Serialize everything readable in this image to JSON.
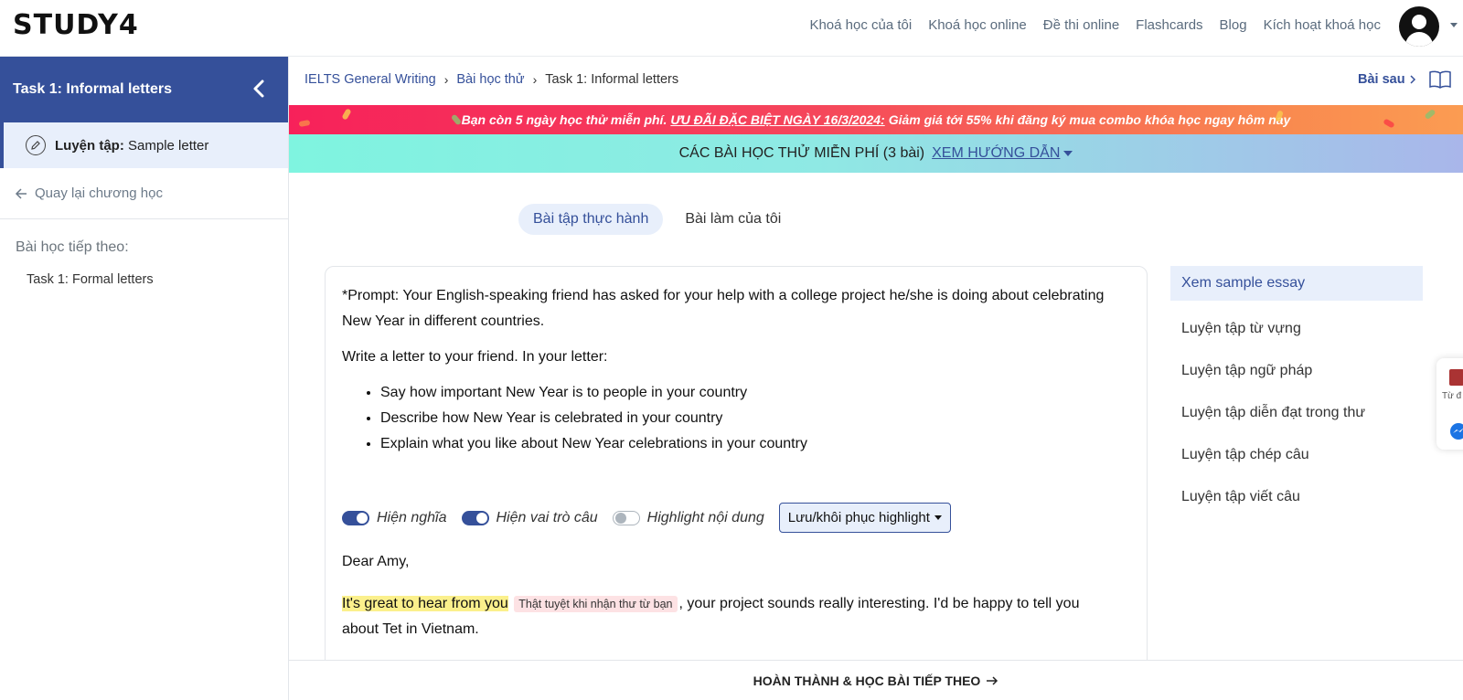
{
  "brand": {
    "logo": "STUDY4"
  },
  "nav": {
    "links": [
      "Khoá học của tôi",
      "Khoá học online",
      "Đề thi online",
      "Flashcards",
      "Blog",
      "Kích hoạt khoá học"
    ]
  },
  "sidebar": {
    "title": "Task 1: Informal letters",
    "active_item": {
      "prefix": "Luyện tập:",
      "label": "Sample letter"
    },
    "back_label": "Quay lại chương học",
    "next_title": "Bài học tiếp theo:",
    "next_item": "Task 1: Formal letters"
  },
  "breadcrumb": [
    "IELTS General Writing",
    "Bài học thử",
    "Task 1: Informal letters"
  ],
  "next_lesson_label": "Bài sau",
  "promo": {
    "lead": "Bạn còn 5 ngày học thử miễn phí.",
    "highlight": "ƯU ĐÃI ĐẶC BIỆT NGÀY 16/3/2024:",
    "tail": "Giảm giá tới 55% khi đăng ký mua combo khóa học ngay hôm nay"
  },
  "free_lessons": {
    "text": "CÁC BÀI HỌC THỬ MIỄN PHÍ (3 bài)",
    "guide": "XEM HƯỚNG DẪN"
  },
  "tabs": [
    {
      "label": "Bài tập thực hành",
      "active": true
    },
    {
      "label": "Bài làm của tôi",
      "active": false
    }
  ],
  "content": {
    "prompt": "*Prompt: Your English-speaking friend has asked for your help with a college project he/she is doing about celebrating New Year in different countries.",
    "instruction": "Write a letter to your friend. In your letter:",
    "bullets": [
      "Say how important New Year is to people in your country",
      "Describe how New Year is celebrated in your country",
      "Explain what you like about New Year celebrations in your country"
    ],
    "toggles": [
      {
        "label": "Hiện nghĩa",
        "on": true
      },
      {
        "label": "Hiện vai trò câu",
        "on": true
      },
      {
        "label": "Highlight nội dung",
        "on": false
      }
    ],
    "highlight_button": "Lưu/khôi phục highlight",
    "greeting": "Dear Amy,",
    "para_highlight": "It's great to hear from you",
    "para_translation": "Thật tuyệt khi nhận thư từ bạn",
    "para_rest": ", your project sounds really interesting. I'd be happy to tell you about Tet in Vietnam."
  },
  "right_menu": [
    {
      "label": "Xem sample essay",
      "active": true
    },
    {
      "label": "Luyện tập từ vựng",
      "active": false
    },
    {
      "label": "Luyện tập ngữ pháp",
      "active": false
    },
    {
      "label": "Luyện tập diễn đạt trong thư",
      "active": false
    },
    {
      "label": "Luyện tập chép câu",
      "active": false
    },
    {
      "label": "Luyện tập viết câu",
      "active": false
    }
  ],
  "float_widget": {
    "label": "Từ đ"
  },
  "bottom_button": "HOÀN THÀNH & HỌC BÀI TIẾP THEO",
  "colors": {
    "primary": "#35509a",
    "active_bg": "#e8effb",
    "highlight": "#fbf08c",
    "translation_bg": "#fde2e4"
  }
}
